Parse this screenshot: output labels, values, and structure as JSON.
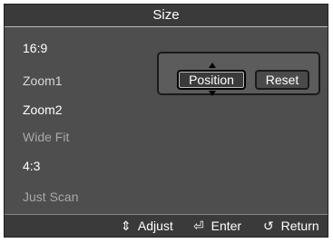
{
  "header": {
    "title": "Size"
  },
  "menu": {
    "items": [
      {
        "label": "16:9"
      },
      {
        "label": "Zoom1"
      },
      {
        "label": "Zoom2"
      },
      {
        "label": "Wide Fit"
      },
      {
        "label": "4:3"
      },
      {
        "label": "Just Scan"
      }
    ]
  },
  "popup": {
    "position_label": "Position",
    "reset_label": "Reset"
  },
  "footer": {
    "adjust_label": "Adjust",
    "enter_label": "Enter",
    "return_label": "Return"
  },
  "icons": {
    "adjust": "updown-arrows-icon",
    "enter": "enter-icon",
    "return": "return-icon"
  }
}
